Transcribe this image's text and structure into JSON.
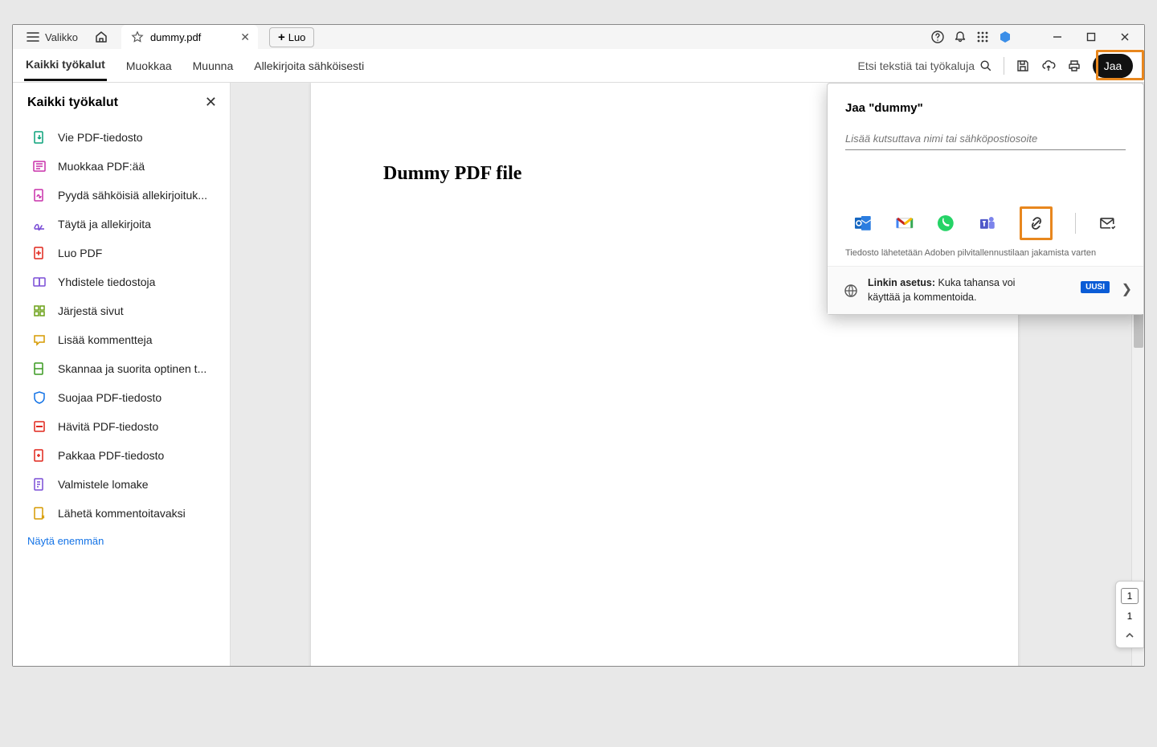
{
  "titlebar": {
    "menu_label": "Valikko",
    "tab_title": "dummy.pdf",
    "create_label": "Luo"
  },
  "toolbar": {
    "items": [
      "Kaikki työkalut",
      "Muokkaa",
      "Muunna",
      "Allekirjoita sähköisesti"
    ],
    "search_placeholder": "Etsi tekstiä tai työkaluja",
    "share_label": "Jaa"
  },
  "sidebar": {
    "title": "Kaikki työkalut",
    "items": [
      "Vie PDF-tiedosto",
      "Muokkaa PDF:ää",
      "Pyydä sähköisiä allekirjoituk...",
      "Täytä ja allekirjoita",
      "Luo PDF",
      "Yhdistele tiedostoja",
      "Järjestä sivut",
      "Lisää kommentteja",
      "Skannaa ja suorita optinen t...",
      "Suojaa PDF-tiedosto",
      "Hävitä PDF-tiedosto",
      "Pakkaa PDF-tiedosto",
      "Valmistele lomake",
      "Lähetä kommentoitavaksi"
    ],
    "show_more": "Näytä enemmän"
  },
  "document": {
    "heading": "Dummy PDF file"
  },
  "share_panel": {
    "title": "Jaa \"dummy\"",
    "input_placeholder": "Lisää kutsuttava nimi tai sähköpostiosoite",
    "note": "Tiedosto lähetetään Adoben pilvitallennustilaan jakamista varten",
    "link_settings_label": "Linkin asetus:",
    "link_settings_value": "Kuka tahansa voi käyttää ja kommentoida.",
    "badge": "UUSI"
  },
  "page_indicator": {
    "current": "1",
    "total": "1"
  },
  "colors": {
    "accent": "#1473e6",
    "highlight": "#e8871e"
  }
}
